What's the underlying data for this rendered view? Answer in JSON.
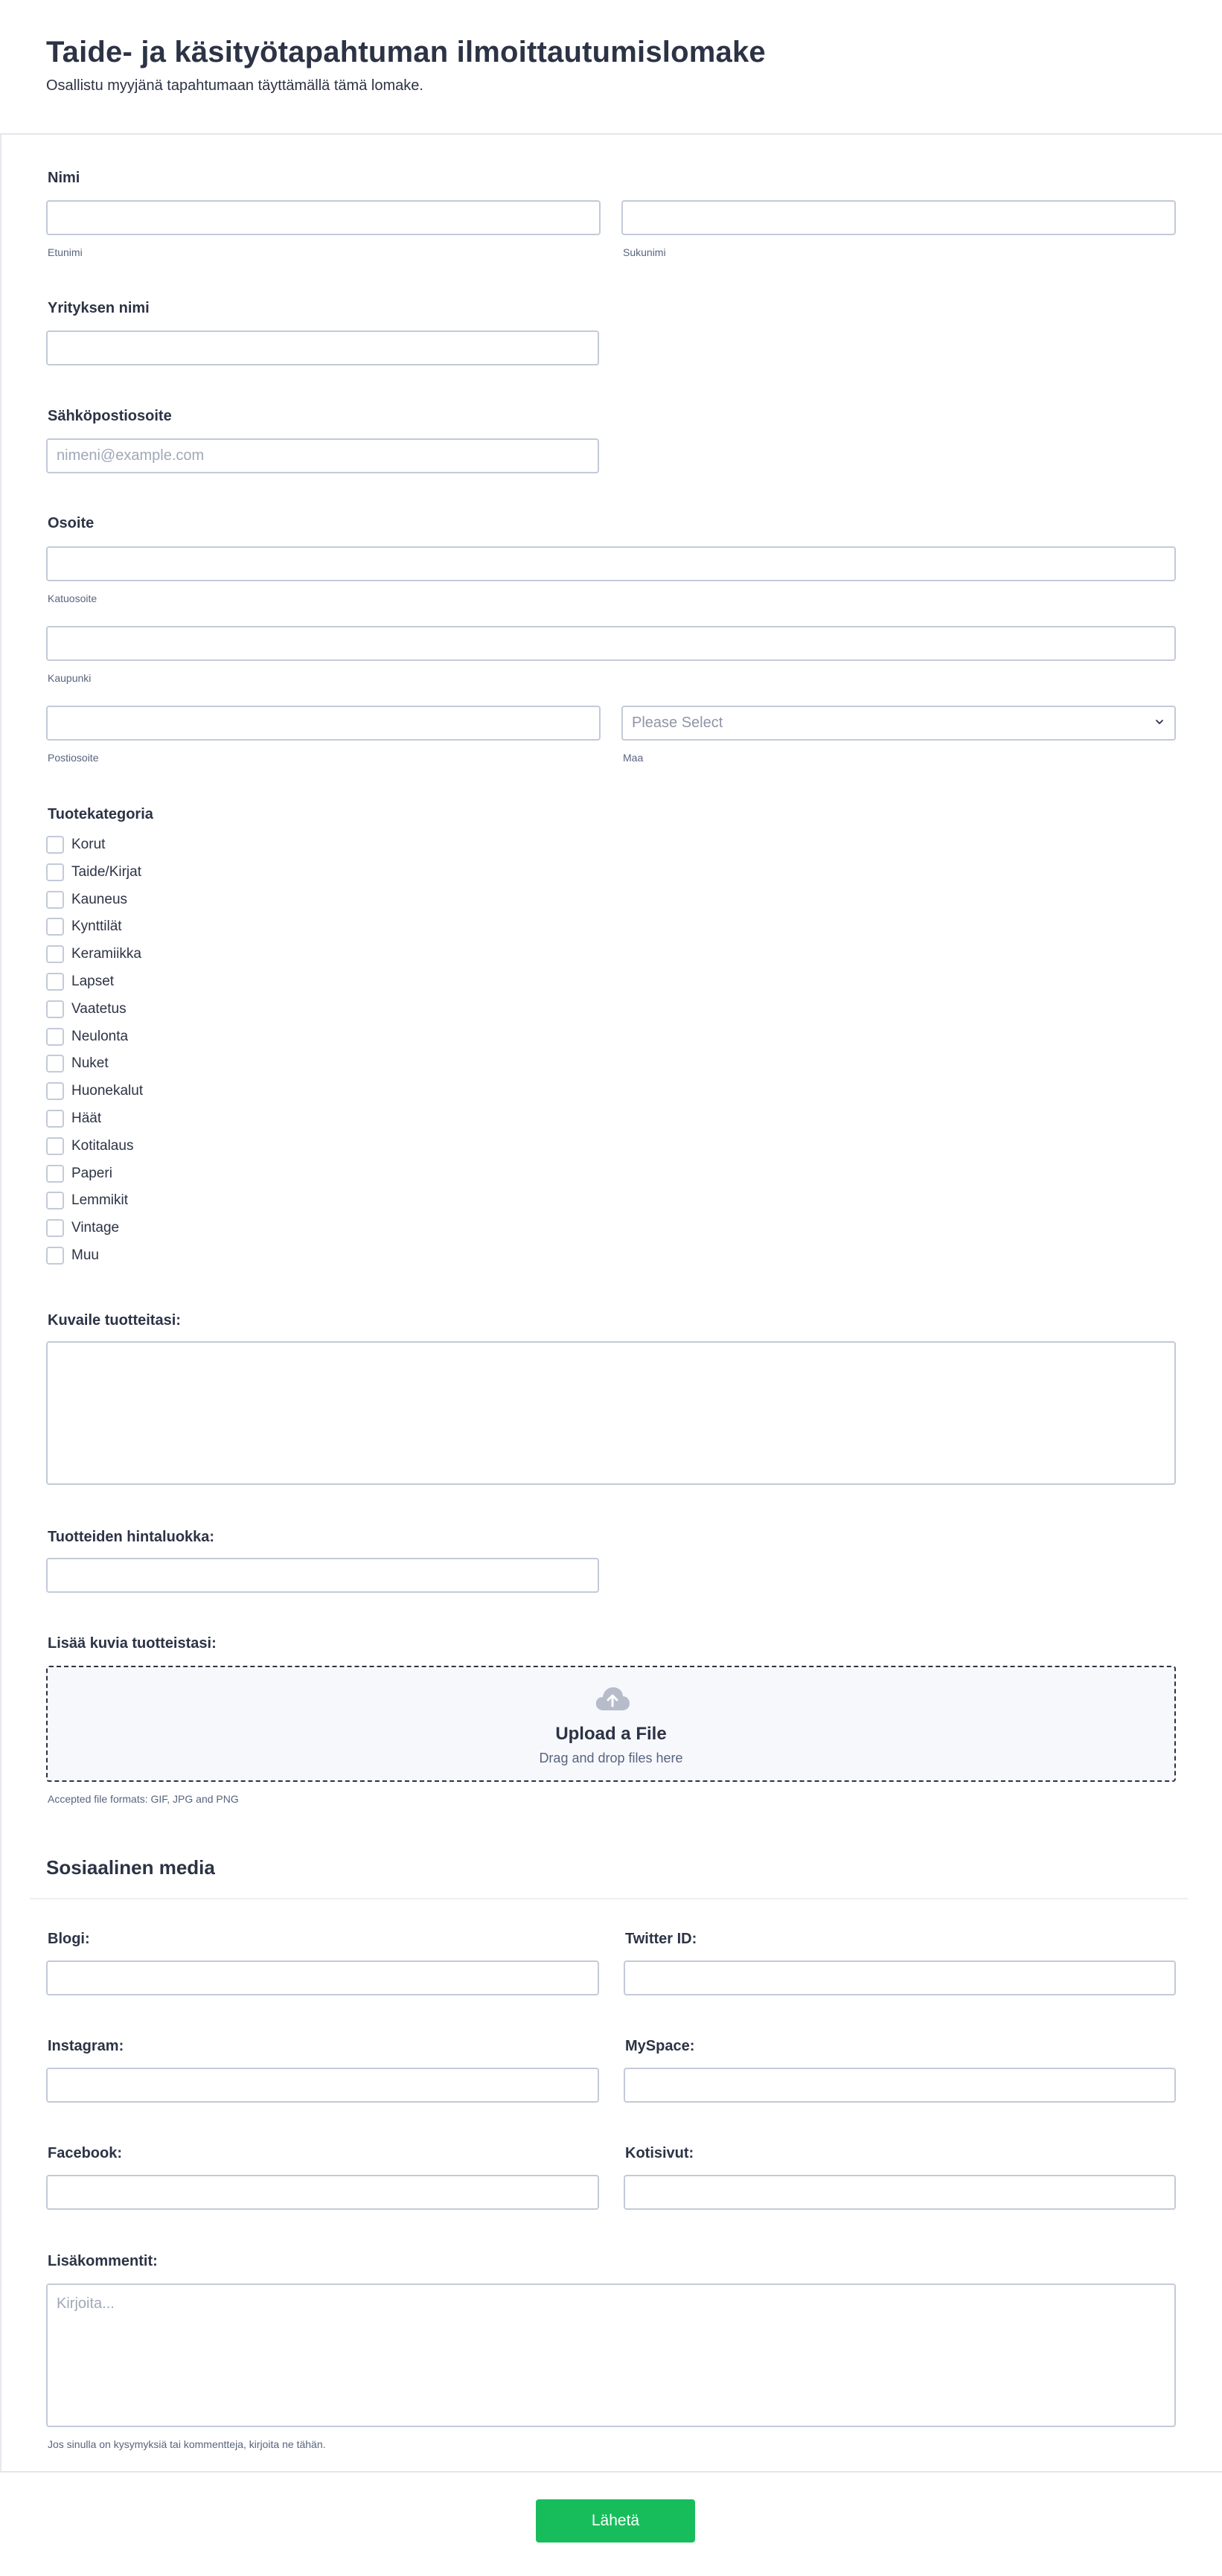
{
  "header": {
    "title": "Taide- ja käsityötapahtuman ilmoittautumislomake",
    "subtitle": "Osallistu myyjänä tapahtumaan täyttämällä tämä lomake."
  },
  "name": {
    "label": "Nimi",
    "first_sublabel": "Etunimi",
    "last_sublabel": "Sukunimi"
  },
  "company": {
    "label": "Yrityksen nimi"
  },
  "email": {
    "label": "Sähköpostiosoite",
    "placeholder": "nimeni@example.com"
  },
  "address": {
    "label": "Osoite",
    "street_sublabel": "Katuosoite",
    "city_sublabel": "Kaupunki",
    "postal_sublabel": "Postiosoite",
    "country_sublabel": "Maa",
    "country_placeholder": "Please Select"
  },
  "categories": {
    "label": "Tuotekategoria",
    "items": [
      "Korut",
      "Taide/Kirjat",
      "Kauneus",
      "Kynttilät",
      "Keramiikka",
      "Lapset",
      "Vaatetus",
      "Neulonta",
      "Nuket",
      "Huonekalut",
      "Häät",
      "Kotitalaus",
      "Paperi",
      "Lemmikit",
      "Vintage",
      "Muu"
    ]
  },
  "describe": {
    "label": "Kuvaile tuotteitasi:"
  },
  "price": {
    "label": "Tuotteiden hintaluokka:"
  },
  "upload": {
    "label": "Lisää kuvia tuotteistasi:",
    "title": "Upload a File",
    "subtitle": "Drag and drop files here",
    "note": "Accepted file formats: GIF, JPG and PNG"
  },
  "social": {
    "title": "Sosiaalinen media",
    "blog_label": "Blogi:",
    "twitter_label": "Twitter ID:",
    "instagram_label": "Instagram:",
    "myspace_label": "MySpace:",
    "facebook_label": "Facebook:",
    "homepage_label": "Kotisivut:"
  },
  "comments": {
    "label": "Lisäkommentit:",
    "placeholder": "Kirjoita...",
    "note": "Jos sinulla on kysymyksiä tai kommentteja, kirjoita ne tähän."
  },
  "submit": {
    "label": "Lähetä"
  },
  "colors": {
    "accent": "#18bd5b",
    "text": "#2c3345",
    "border": "#c3cad8"
  },
  "icons": {
    "upload": "cloud-upload-icon",
    "select": "chevron-down-icon"
  }
}
